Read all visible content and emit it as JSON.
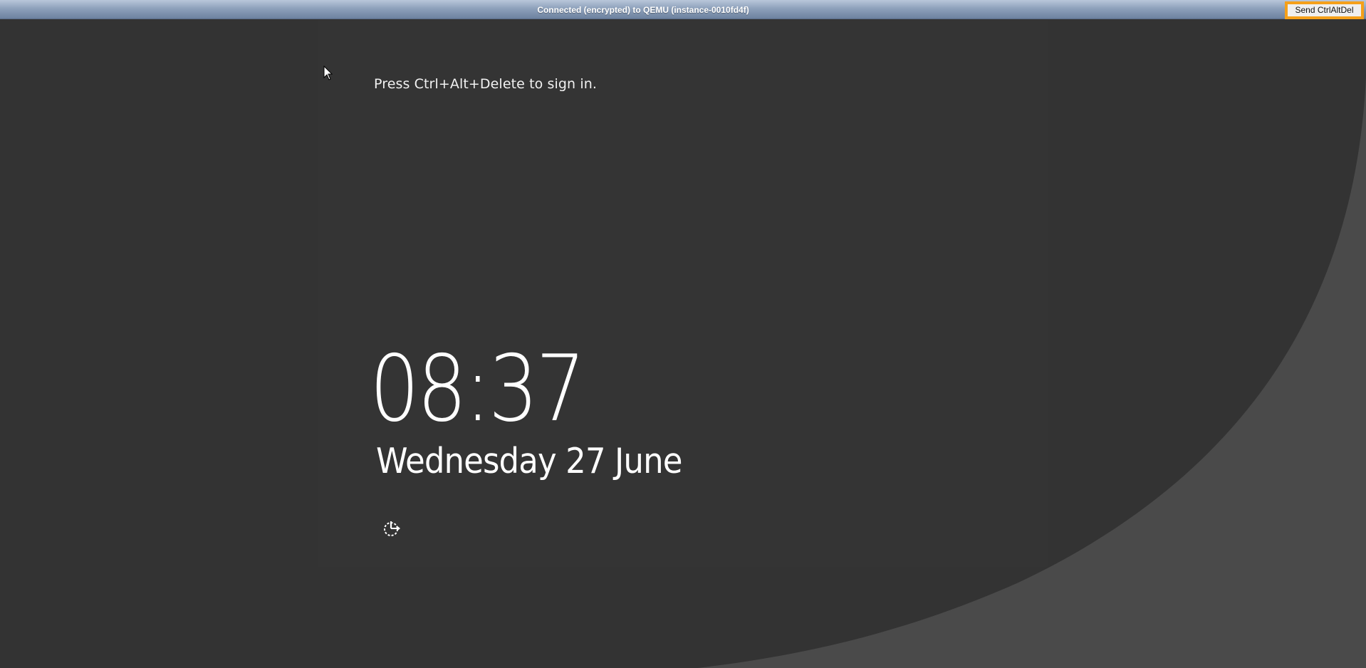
{
  "toolbar": {
    "status": "Connected (encrypted) to QEMU (instance-0010fd4f)",
    "send_cad_label": "Send CtrlAltDel"
  },
  "lock_screen": {
    "prompt": "Press Ctrl+Alt+Delete to sign in.",
    "time": "08:37",
    "date": "Wednesday 27 June",
    "status_icon": "ease-of-access-icon"
  },
  "colors": {
    "background": "#333333",
    "swoosh": "#4a4a4a",
    "text": "#ffffff",
    "button_border": "#f5a01a",
    "toolbar_top": "#b9c7da",
    "toolbar_bottom": "#6d82a0"
  },
  "icons": [
    "mouse-pointer-icon",
    "ease-of-access-icon"
  ]
}
